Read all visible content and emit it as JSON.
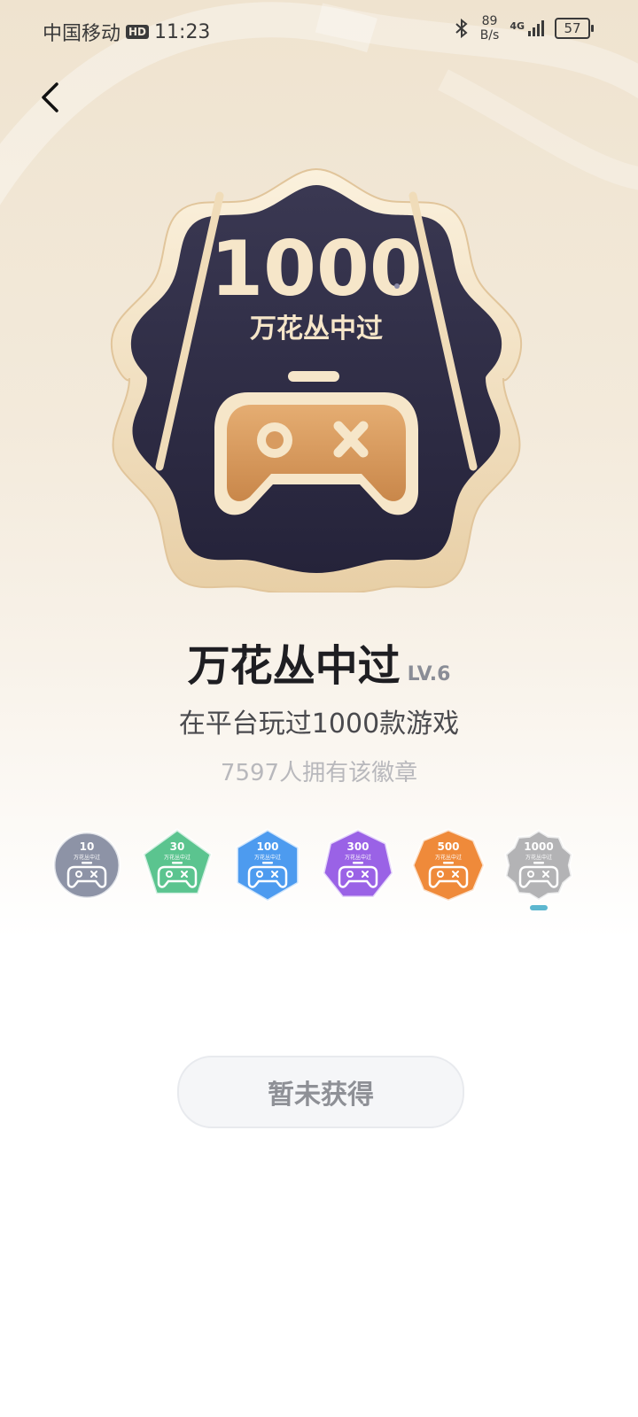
{
  "status_bar": {
    "carrier": "中国移动",
    "hd_label": "HD",
    "time": "11:23",
    "net_speed_value": "89",
    "net_speed_unit": "B/s",
    "network": "4G",
    "battery": "57"
  },
  "badge": {
    "count_label": "1000",
    "emblem_name": "万花丛中过",
    "title": "万花丛中过",
    "level": "LV.6",
    "description": "在平台玩过1000款游戏",
    "owners": "7597人拥有该徽章"
  },
  "levels": [
    {
      "count": "10",
      "name": "万花丛中过",
      "color": "#8d93a6",
      "shape": "circle"
    },
    {
      "count": "30",
      "name": "万花丛中过",
      "color": "#5bc48f",
      "shape": "pentagon"
    },
    {
      "count": "100",
      "name": "万花丛中过",
      "color": "#4d9bef",
      "shape": "hexagon"
    },
    {
      "count": "300",
      "name": "万花丛中过",
      "color": "#9a62e6",
      "shape": "heptagon"
    },
    {
      "count": "500",
      "name": "万花丛中过",
      "color": "#ef8a3a",
      "shape": "octagon"
    },
    {
      "count": "1000",
      "name": "万花丛中过",
      "color": "#b3b3b5",
      "shape": "flower"
    }
  ],
  "selected_level_index": 5,
  "action_button": {
    "label": "暂未获得"
  },
  "colors": {
    "badge_dark": "#2f2d44",
    "badge_gold": "#f4e4c8",
    "controller": "#d79a5d",
    "indicator": "#5db7cf"
  }
}
